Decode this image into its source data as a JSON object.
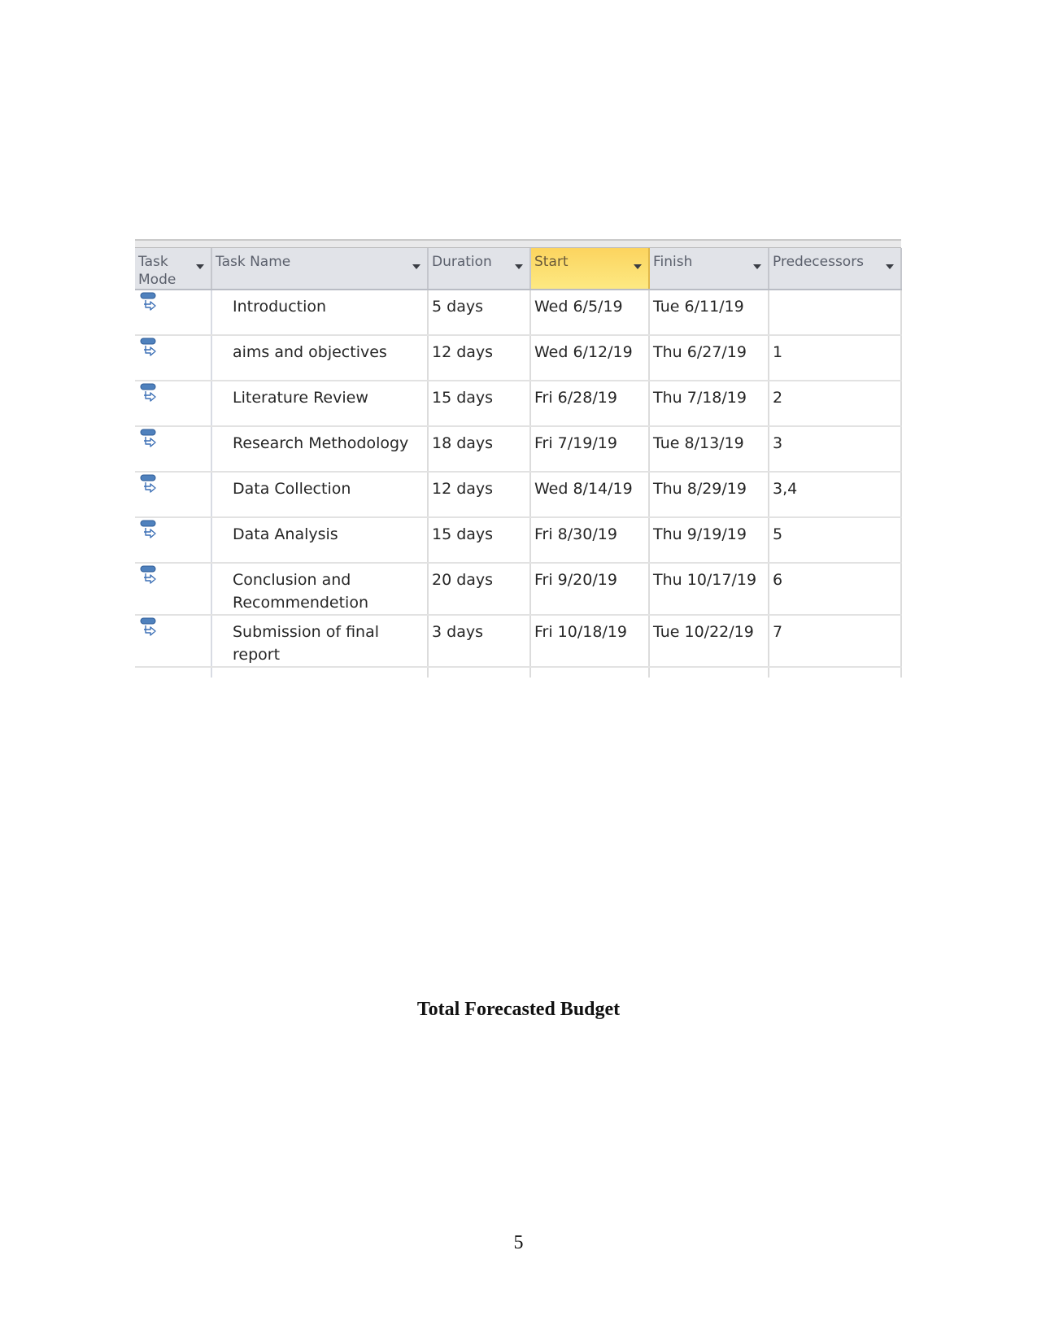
{
  "table": {
    "columns": [
      {
        "label": "Task Mode"
      },
      {
        "label": "Task Name"
      },
      {
        "label": "Duration"
      },
      {
        "label": "Start"
      },
      {
        "label": "Finish"
      },
      {
        "label": "Predecessors"
      }
    ],
    "selected_column": "Start",
    "task_mode_icon": "auto-scheduled-task-icon",
    "colors": {
      "header_bg": "#e1e3e8",
      "selected_header": "#fcd45f",
      "icon_blue": "#4f81bd"
    },
    "rows": [
      {
        "name": "Introduction",
        "duration": "5 days",
        "start": "Wed 6/5/19",
        "finish": "Tue 6/11/19",
        "predecessors": ""
      },
      {
        "name": "aims and objectives",
        "duration": "12 days",
        "start": "Wed 6/12/19",
        "finish": "Thu 6/27/19",
        "predecessors": "1"
      },
      {
        "name": "Literature Review",
        "duration": "15 days",
        "start": "Fri 6/28/19",
        "finish": "Thu 7/18/19",
        "predecessors": "2"
      },
      {
        "name": "Research Methodology",
        "duration": "18 days",
        "start": "Fri 7/19/19",
        "finish": "Tue 8/13/19",
        "predecessors": "3"
      },
      {
        "name": "Data Collection",
        "duration": "12 days",
        "start": "Wed 8/14/19",
        "finish": "Thu 8/29/19",
        "predecessors": "3,4"
      },
      {
        "name": "Data Analysis",
        "duration": "15 days",
        "start": "Fri 8/30/19",
        "finish": "Thu 9/19/19",
        "predecessors": "5"
      },
      {
        "name": "Conclusion and Recommendetion",
        "duration": "20 days",
        "start": "Fri 9/20/19",
        "finish": "Thu 10/17/19",
        "predecessors": "6"
      },
      {
        "name": "Submission of final report",
        "duration": "3 days",
        "start": "Fri 10/18/19",
        "finish": "Tue 10/22/19",
        "predecessors": "7"
      }
    ]
  },
  "heading": "Total Forecasted Budget",
  "page_number": "5"
}
